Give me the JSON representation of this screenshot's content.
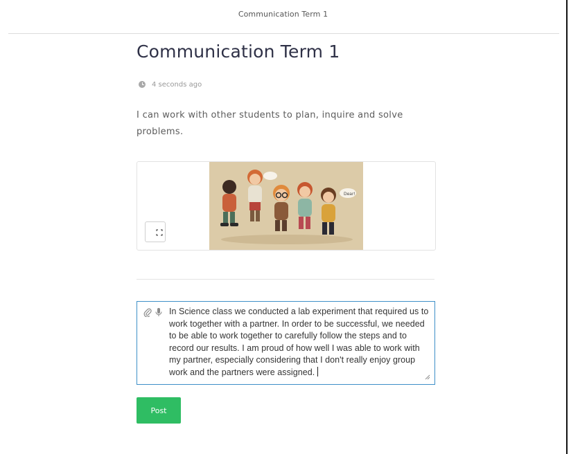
{
  "topbar": {
    "title": "Communication Term 1"
  },
  "post": {
    "title": "Communication Term 1",
    "timestamp": "4 seconds ago",
    "description": " I can work with other students to plan, inquire and solve problems."
  },
  "media": {
    "expand_icon": "expand-icon",
    "illustration": "cartoon children talking in a group",
    "speech_bubble_text": "Dear!"
  },
  "composer": {
    "icons": [
      "paperclip-icon",
      "microphone-icon"
    ],
    "text": "In Science class we conducted a lab experiment that required us to work together with a partner. In order to be successful, we needed to be able to work together to carefully follow the steps and to record our results. I am proud of how well I was able to work with my partner, especially considering that I don't really enjoy group work and the partners were assigned."
  },
  "actions": {
    "post_label": "Post"
  },
  "colors": {
    "accent_green": "#2fbd63",
    "focus_border": "#3d8fc8",
    "title_text": "#2f3147",
    "illustration_bg": "#dccba8"
  }
}
